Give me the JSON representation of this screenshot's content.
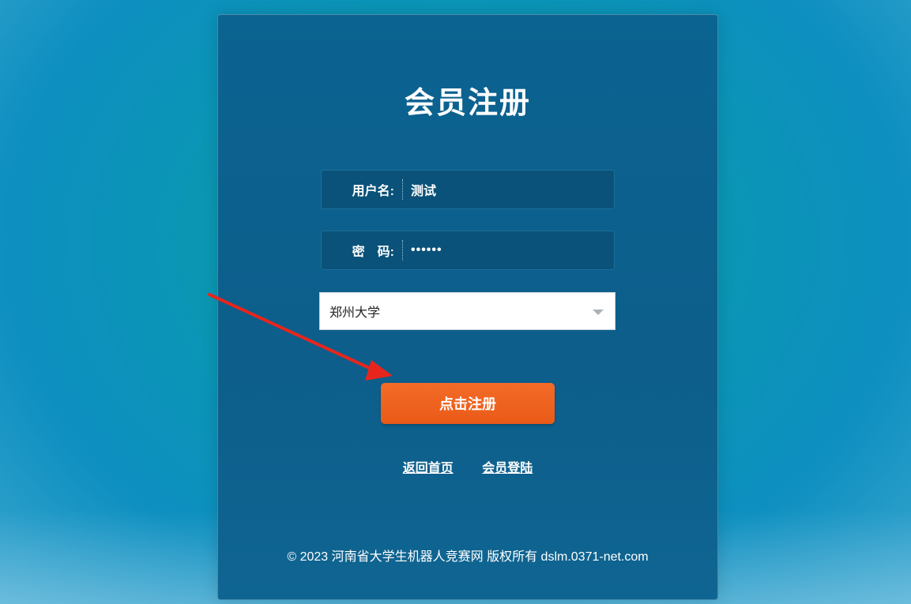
{
  "page": {
    "title": "会员注册"
  },
  "form": {
    "username": {
      "label": "用户名:",
      "value": "测试"
    },
    "password": {
      "label": "密　码:",
      "value": "••••••"
    },
    "school": {
      "selected": "郑州大学"
    },
    "submit_label": "点击注册"
  },
  "links": {
    "home": "返回首页",
    "login": "会员登陆"
  },
  "footer": {
    "text": "© 2023 河南省大学生机器人竞赛网 版权所有 dslm.0371-net.com"
  },
  "colors": {
    "accent": "#f36b28",
    "card": "#0b6391",
    "arrow": "#e8251c"
  }
}
